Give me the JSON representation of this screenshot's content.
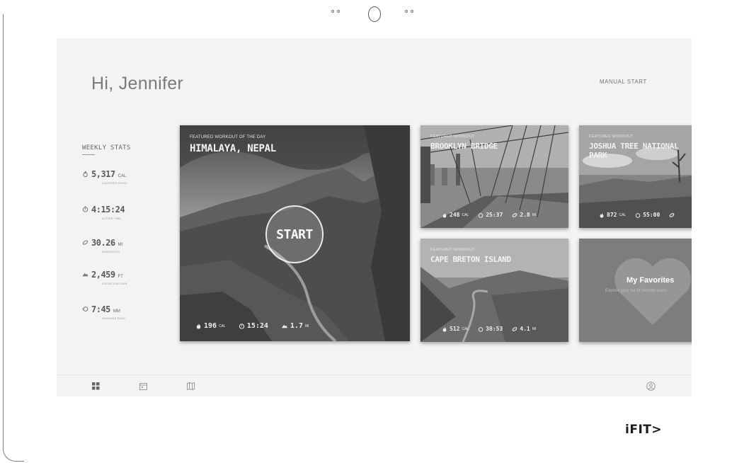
{
  "header": {
    "greeting": "Hi, Jennifer",
    "manual_start": "MANUAL START"
  },
  "weekly_stats": {
    "title": "WEEKLY STATS",
    "items": [
      {
        "icon": "flame-icon",
        "value": "5,317",
        "unit": "CAL",
        "label": "CALORIES BURN"
      },
      {
        "icon": "stopwatch-icon",
        "value": "4:15:24",
        "unit": "",
        "label": "ACTIVE TIME"
      },
      {
        "icon": "distance-icon",
        "value": "30.26",
        "unit": "MI",
        "label": "WORKOUTS"
      },
      {
        "icon": "elevation-icon",
        "value": "2,459",
        "unit": "FT",
        "label": "ELEVATION GAIN"
      },
      {
        "icon": "pace-icon",
        "value": "7:45",
        "unit": "MM",
        "label": "AVERAGE PACE"
      }
    ]
  },
  "featured_main": {
    "kicker": "FEATURED WORKOUT OF THE DAY",
    "title": "HIMALAYA, NEPAL",
    "start_label": "START",
    "metrics": [
      {
        "icon": "flame-icon",
        "value": "196",
        "unit": "CAL"
      },
      {
        "icon": "stopwatch-icon",
        "value": "15:24",
        "unit": ""
      },
      {
        "icon": "elevation-icon",
        "value": "1.7",
        "unit": "MI"
      }
    ]
  },
  "cards": [
    {
      "kicker": "FEATURED WORKOUT",
      "title": "BROOKLYN BRIDGE",
      "metrics": [
        {
          "icon": "flame-icon",
          "value": "248",
          "unit": "CAL"
        },
        {
          "icon": "stopwatch-icon",
          "value": "25:37",
          "unit": ""
        },
        {
          "icon": "distance-icon",
          "value": "2.8",
          "unit": "MI"
        }
      ]
    },
    {
      "kicker": "FEATURED WORKOUT",
      "title": "JOSHUA TREE NATIONAL PARK",
      "metrics": [
        {
          "icon": "flame-icon",
          "value": "872",
          "unit": "CAL"
        },
        {
          "icon": "stopwatch-icon",
          "value": "55:00",
          "unit": ""
        },
        {
          "icon": "distance-icon",
          "value": "",
          "unit": ""
        }
      ]
    },
    {
      "kicker": "FEATURED WORKOUT",
      "title": "CAPE BRETON ISLAND",
      "metrics": [
        {
          "icon": "flame-icon",
          "value": "512",
          "unit": "CAL"
        },
        {
          "icon": "stopwatch-icon",
          "value": "38:53",
          "unit": ""
        },
        {
          "icon": "distance-icon",
          "value": "4.1",
          "unit": "MI"
        }
      ]
    }
  ],
  "favorites": {
    "title": "My Favorites",
    "subtitle": "Explore your list of favorite workc"
  },
  "bottom_nav": [
    "dashboard-icon",
    "calendar-icon",
    "map-icon",
    "profile-icon"
  ],
  "brand": {
    "logo": "iFIT>"
  }
}
